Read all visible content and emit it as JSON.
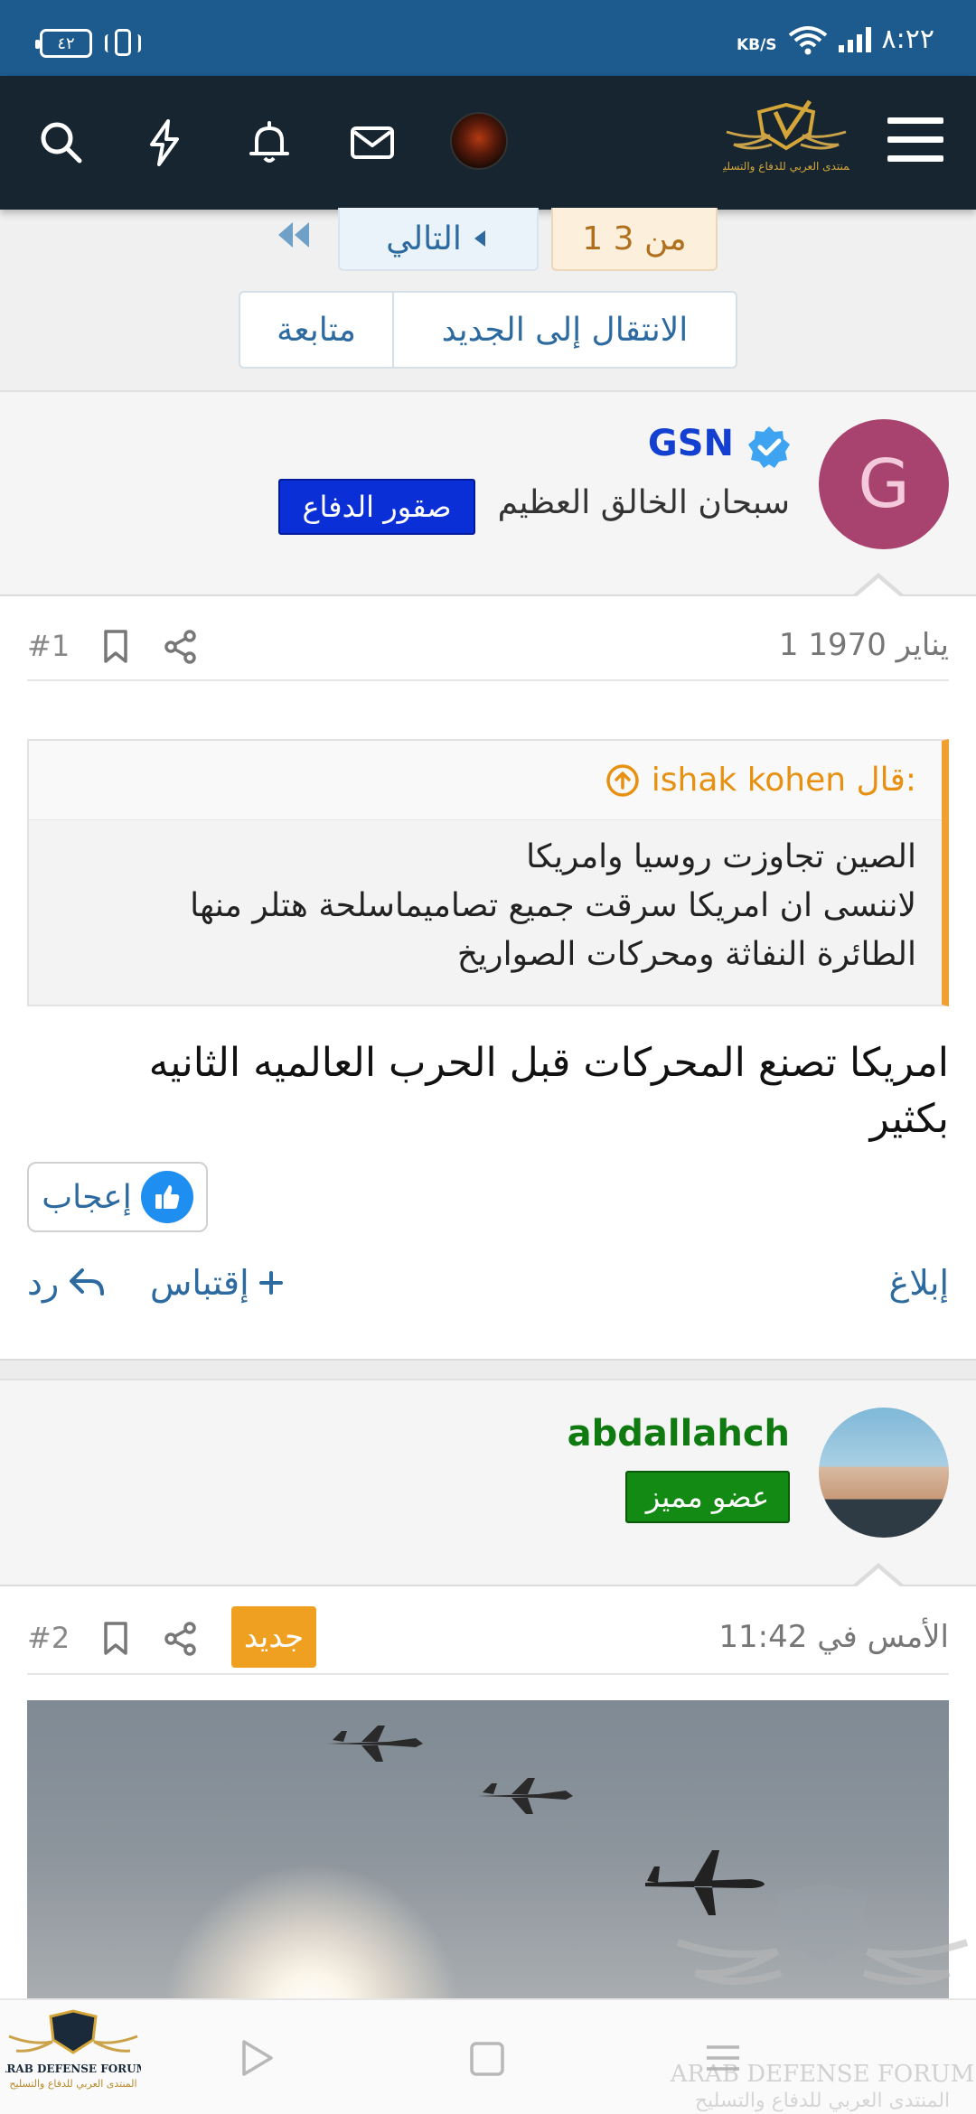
{
  "status_bar": {
    "time": "٨:٢٢",
    "speed_unit": "KB/S",
    "battery": "٤٢"
  },
  "header": {
    "icons": [
      "search-icon",
      "bolt-icon",
      "bell-icon",
      "mail-icon"
    ]
  },
  "pagination": {
    "current": "1 من 3",
    "next": "التالي",
    "jump_new": "الانتقال إلى الجديد",
    "follow": "متابعة"
  },
  "posts": [
    {
      "avatar_letter": "G",
      "username": "GSN",
      "user_title": "سبحان الخالق العظيم",
      "badge": "صقور الدفاع",
      "date": "1 يناير 1970",
      "number": "#1",
      "quote": {
        "author": "ishak kohen قال:",
        "line1": "الصين تجاوزت روسيا وامريكا",
        "line2": "لاننسى ان امريكا سرقت جميع تصاميماسلحة هتلر منها",
        "line3": "الطائرة النفاثة ومحركات الصواريخ"
      },
      "message_line1": "امريكا تصنع المحركات قبل الحرب العالميه الثانيه",
      "message_line2": "بكثير",
      "like": "إعجاب",
      "report": "إبلاغ",
      "quote_action": "إقتباس",
      "reply": "رد"
    },
    {
      "username": "abdallahch",
      "badge": "عضو مميز",
      "new_badge": "جديد",
      "date": "الأمس في 11:42",
      "number": "#2"
    }
  ],
  "watermark": {
    "line1": "ARAB DEFENSE FORUM",
    "line2": "المنتدى العربي للدفاع والتسليح"
  },
  "logo_text": "المنتدى العربي للدفاع والتسليح",
  "colors": {
    "status_bar": "#1d5a8e",
    "header": "#162530",
    "link": "#2c6aa0",
    "accent_orange": "#f0a020",
    "badge_blue": "#0a2fd6",
    "badge_green": "#138a13"
  }
}
